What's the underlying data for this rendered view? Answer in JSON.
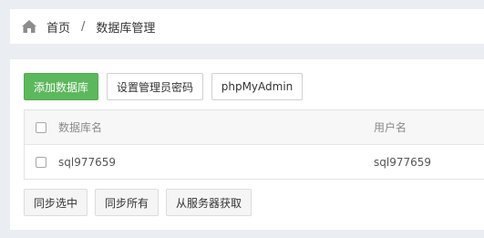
{
  "breadcrumb": {
    "home_label": "首页",
    "separator": "/",
    "current_label": "数据库管理"
  },
  "toolbar": {
    "add_db_label": "添加数据库",
    "set_root_pwd_label": "设置管理员密码",
    "phpmyadmin_label": "phpMyAdmin"
  },
  "table": {
    "headers": {
      "name": "数据库名",
      "user": "用户名"
    },
    "rows": [
      {
        "name": "sql977659",
        "user": "sql977659"
      }
    ]
  },
  "actions": {
    "sync_selected_label": "同步选中",
    "sync_all_label": "同步所有",
    "fetch_from_server_label": "从服务器获取"
  },
  "colors": {
    "primary_green": "#5cb85c",
    "page_bg": "#eaedf1"
  }
}
